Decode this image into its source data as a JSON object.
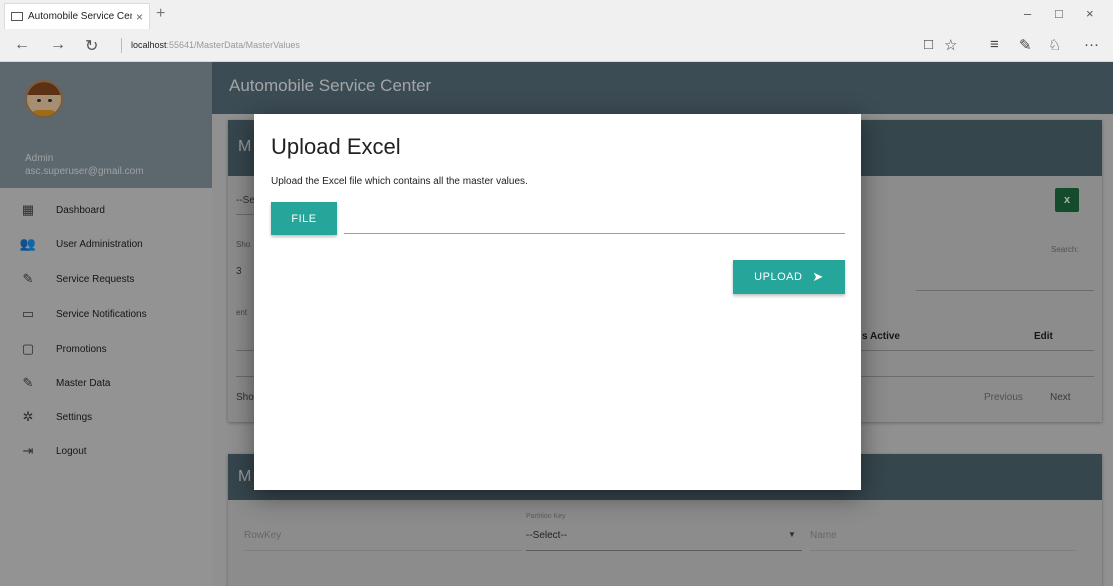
{
  "browser": {
    "tab_title": "Automobile Service Cen",
    "tab_close": "×",
    "new_tab": "+",
    "url_host": "localhost",
    "url_rest": ":55641/MasterData/MasterValues",
    "icons": {
      "back": "←",
      "forward": "→",
      "refresh": "↻",
      "reading_view": "□",
      "favorite": "☆",
      "hub": "≡",
      "notes": "✎",
      "share": "♘",
      "more": "···",
      "minimize": "–",
      "maximize": "□",
      "close": "×"
    }
  },
  "sidebar": {
    "user_name": "Admin",
    "user_email": "asc.superuser@gmail.com",
    "items": [
      {
        "label": "Dashboard",
        "icon": "dashboard-icon",
        "glyph": "▦"
      },
      {
        "label": "User Administration",
        "icon": "users-icon",
        "glyph": "👥"
      },
      {
        "label": "Service Requests",
        "icon": "wrench-icon",
        "glyph": "✎"
      },
      {
        "label": "Service Notifications",
        "icon": "message-icon",
        "glyph": "▭"
      },
      {
        "label": "Promotions",
        "icon": "promotions-icon",
        "glyph": "▢"
      },
      {
        "label": "Master Data",
        "icon": "master-data-icon",
        "glyph": "✎"
      },
      {
        "label": "Settings",
        "icon": "gear-icon",
        "glyph": "✲"
      },
      {
        "label": "Logout",
        "icon": "logout-icon",
        "glyph": "⇥"
      }
    ]
  },
  "header": {
    "app_title": "Automobile Service Center"
  },
  "background": {
    "card_title_fragment": "M",
    "select_fragment": "--Se",
    "show_fragment": "Sho",
    "show_value": "3",
    "entries_fragment": "ent",
    "showing_fragment": "Sho",
    "search_label": "Search:",
    "col_is_active": "s Active",
    "col_edit": "Edit",
    "prev_label": "Previous",
    "next_label": "Next",
    "card2_title_fragment": "M",
    "rowkey_placeholder": "RowKey",
    "partition_key_label": "Partition Key",
    "partition_key_value": "--Select--",
    "name_placeholder": "Name",
    "excel_label": "x"
  },
  "modal": {
    "title": "Upload Excel",
    "description": "Upload the Excel file which contains all the master values.",
    "file_button": "FILE",
    "file_path_value": "",
    "upload_button": "UPLOAD",
    "upload_icon": "➤"
  },
  "colors": {
    "accent": "#26a69a",
    "header": "#59707c",
    "card_header": "#506772",
    "sidebar_profile": "#8a9aa3"
  }
}
